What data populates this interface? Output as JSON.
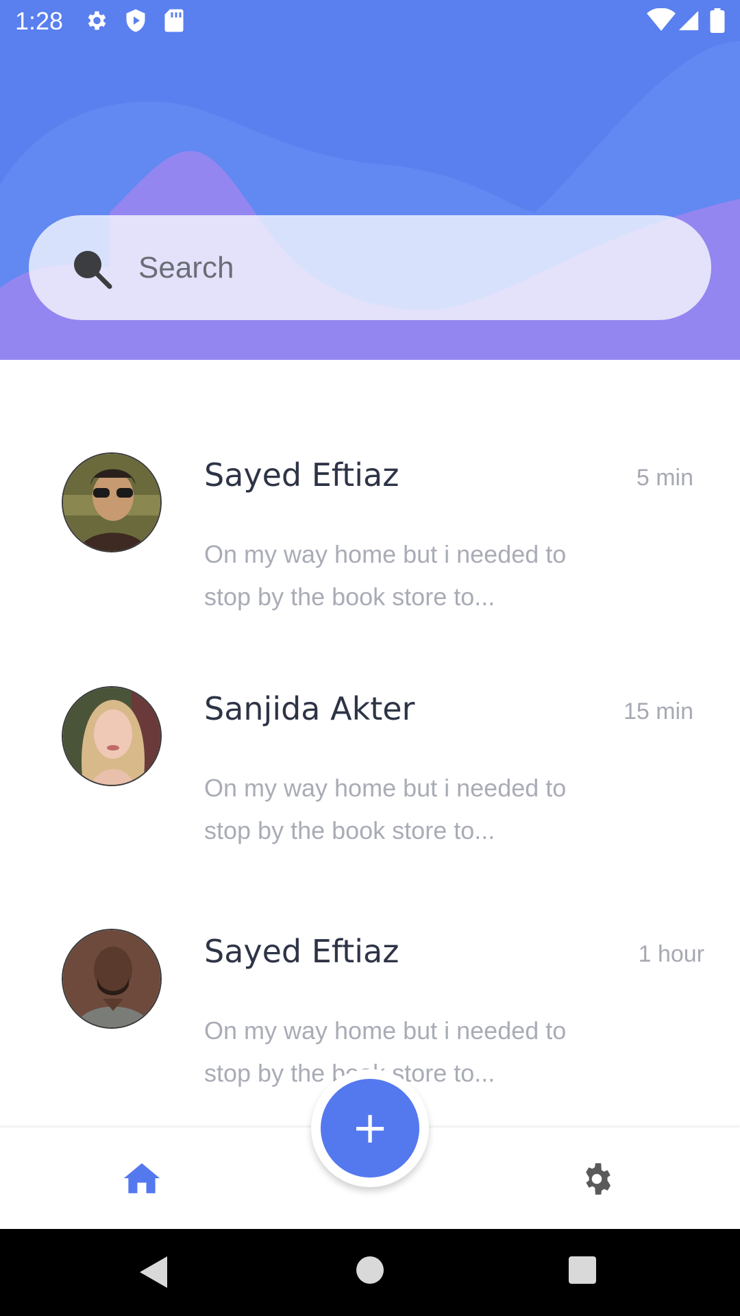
{
  "status_bar": {
    "time": "1:28",
    "left_icons": [
      "gear-icon",
      "shield-play-icon",
      "sd-card-icon"
    ],
    "right_icons": [
      "wifi-icon",
      "signal-icon",
      "battery-icon"
    ]
  },
  "search": {
    "placeholder": "Search"
  },
  "conversations": [
    {
      "name": "Sayed Eftiaz",
      "time": "5 min",
      "message": "On my way home but i needed to stop by the book store to..."
    },
    {
      "name": "Sanjida Akter",
      "time": "15 min",
      "message": "On my way home but i needed to stop by the book store to..."
    },
    {
      "name": "Sayed Eftiaz",
      "time": "1 hour",
      "message": "On my way home but i needed to stop by the book store to..."
    }
  ],
  "fab": {
    "label": "+"
  },
  "bottom_nav": {
    "items": [
      "home-icon",
      "settings-icon"
    ]
  },
  "colors": {
    "primary": "#5478ee",
    "header_wave_purple": "#9486f0",
    "header_blue": "#5a7fef"
  }
}
